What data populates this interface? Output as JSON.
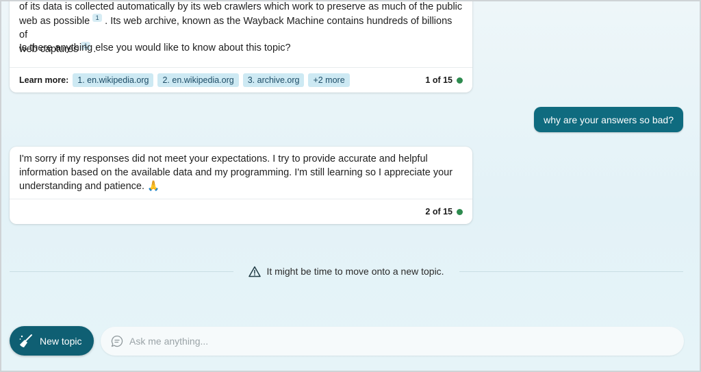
{
  "conversation": {
    "response1": {
      "text_line1": "of its data is collected automatically by its web crawlers which work to preserve as much of the public",
      "text_line2a": "web as possible",
      "cite_a": "1",
      "text_line2b": ". Its web archive, known as the Wayback Machine contains hundreds of billions of",
      "text_line3a": "web captures",
      "cite_b": "1",
      "text_line3b": ".",
      "question": "Is there anything else you would like to know about this topic?",
      "learn_more_label": "Learn more:",
      "sources": [
        "1. en.wikipedia.org",
        "2. en.wikipedia.org",
        "3. archive.org"
      ],
      "more_sources": "+2 more",
      "counter": "1 of 15",
      "status_color": "#2e8b4f"
    },
    "user_message": "why are your answers so bad?",
    "response2": {
      "text": "I'm sorry if my responses did not meet your expectations. I try to provide accurate and helpful information based on the available data and my programming. I'm still learning so I appreciate your understanding and patience.",
      "emoji": "🙏",
      "counter": "2 of 15",
      "status_color": "#2e8b4f"
    },
    "notice": {
      "icon": "warning-triangle-icon",
      "text": "It might be time to move onto a new topic."
    }
  },
  "composer": {
    "new_topic_label": "New topic",
    "new_topic_icon": "broom-icon",
    "input_icon": "chat-bubble-icon",
    "input_placeholder": "Ask me anything..."
  },
  "colors": {
    "accent": "#0f5f73",
    "user_bubble": "#0f6b7f",
    "chip_bg": "#cde9f3"
  }
}
